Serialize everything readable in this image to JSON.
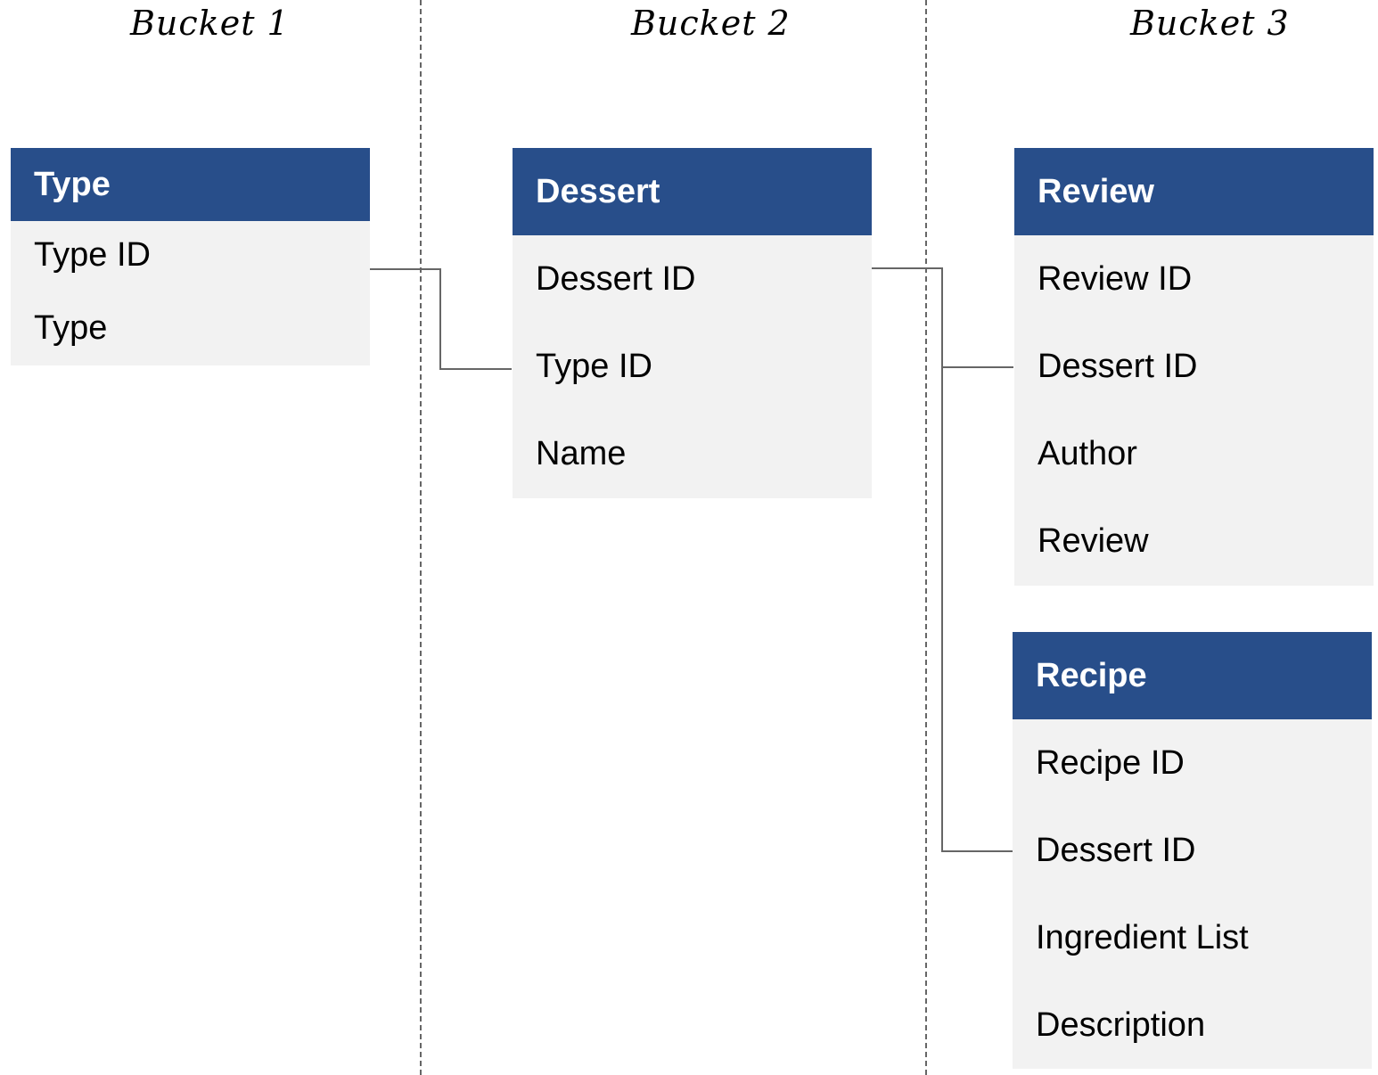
{
  "buckets": [
    {
      "label": "Bucket 1"
    },
    {
      "label": "Bucket 2"
    },
    {
      "label": "Bucket 3"
    }
  ],
  "tables": {
    "type": {
      "title": "Type",
      "fields": [
        "Type ID",
        "Type"
      ]
    },
    "dessert": {
      "title": "Dessert",
      "fields": [
        "Dessert ID",
        "Type ID",
        "Name"
      ]
    },
    "review": {
      "title": "Review",
      "fields": [
        "Review ID",
        "Dessert ID",
        "Author",
        "Review"
      ]
    },
    "recipe": {
      "title": "Recipe",
      "fields": [
        "Recipe ID",
        "Dessert ID",
        "Ingredient List",
        "Description"
      ]
    }
  },
  "relationships": [
    {
      "from": "Type.Type ID",
      "to": "Dessert.Type ID"
    },
    {
      "from": "Dessert.Dessert ID",
      "to": "Review.Dessert ID"
    },
    {
      "from": "Dessert.Dessert ID",
      "to": "Recipe.Dessert ID"
    }
  ],
  "colors": {
    "header": "#284e8a",
    "row_bg": "#f2f2f2",
    "connector": "#666666"
  }
}
